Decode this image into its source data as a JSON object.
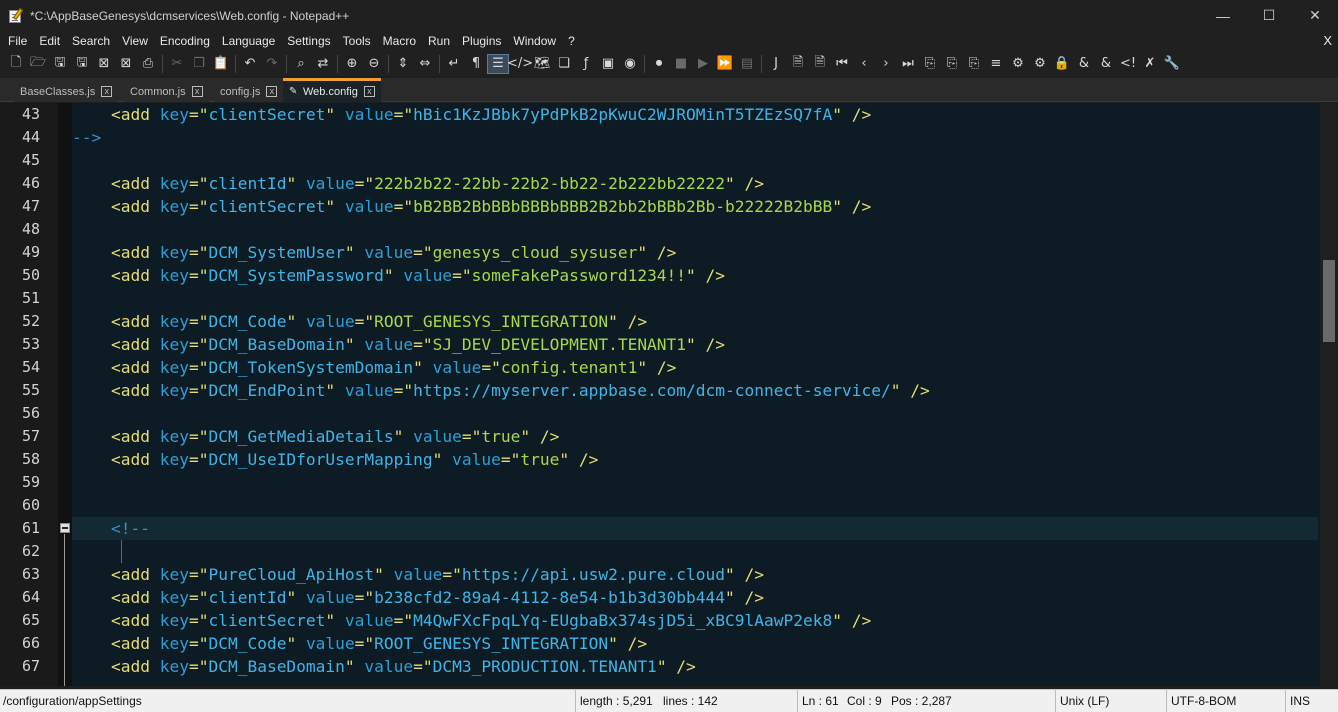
{
  "window": {
    "title": "*C:\\AppBaseGenesys\\dcmservices\\Web.config - Notepad++",
    "minimize_glyph": "—",
    "maximize_glyph": "☐",
    "close_glyph": "✕"
  },
  "menu": {
    "items": [
      "File",
      "Edit",
      "Search",
      "View",
      "Encoding",
      "Language",
      "Settings",
      "Tools",
      "Macro",
      "Run",
      "Plugins",
      "Window",
      "?"
    ],
    "close_glyph": "X"
  },
  "tabs": [
    {
      "label": "BaseClasses.js",
      "active": false
    },
    {
      "label": "Common.js",
      "active": false
    },
    {
      "label": "config.js",
      "active": false
    },
    {
      "label": "Web.config",
      "active": true
    }
  ],
  "tab_close_glyph": "x",
  "editor": {
    "current_line": 61,
    "lines": [
      {
        "n": "43",
        "parts": [
          [
            "t",
            "    <add "
          ],
          [
            "a",
            "key"
          ],
          [
            "t",
            "=\""
          ],
          [
            "s",
            "clientSecret"
          ],
          [
            "t",
            "\" "
          ],
          [
            "a",
            "value"
          ],
          [
            "t",
            "=\""
          ],
          [
            "s",
            "hBic1KzJBbk7yPdPkB2pKwuC2WJROMinT5TZEzSQ7fA"
          ],
          [
            "t",
            "\" />"
          ]
        ]
      },
      {
        "n": "44",
        "parts": [
          [
            "c",
            "-->"
          ]
        ]
      },
      {
        "n": "45",
        "parts": []
      },
      {
        "n": "46",
        "parts": [
          [
            "t",
            "    <add "
          ],
          [
            "a",
            "key"
          ],
          [
            "t",
            "=\""
          ],
          [
            "s",
            "clientId"
          ],
          [
            "t",
            "\" "
          ],
          [
            "a",
            "value"
          ],
          [
            "t",
            "=\""
          ],
          [
            "g",
            "222b2b22-22bb-22b2-bb22-2b222bb22222"
          ],
          [
            "t",
            "\" />"
          ]
        ]
      },
      {
        "n": "47",
        "parts": [
          [
            "t",
            "    <add "
          ],
          [
            "a",
            "key"
          ],
          [
            "t",
            "=\""
          ],
          [
            "s",
            "clientSecret"
          ],
          [
            "t",
            "\" "
          ],
          [
            "a",
            "value"
          ],
          [
            "t",
            "=\""
          ],
          [
            "g",
            "bB2BB2BbBBbBBBbBBB2B2bb2bBBb2Bb-b22222B2bBB"
          ],
          [
            "t",
            "\" />"
          ]
        ]
      },
      {
        "n": "48",
        "parts": []
      },
      {
        "n": "49",
        "parts": [
          [
            "t",
            "    <add "
          ],
          [
            "a",
            "key"
          ],
          [
            "t",
            "=\""
          ],
          [
            "s",
            "DCM_SystemUser"
          ],
          [
            "t",
            "\" "
          ],
          [
            "a",
            "value"
          ],
          [
            "t",
            "=\""
          ],
          [
            "g",
            "genesys_cloud_sysuser"
          ],
          [
            "t",
            "\" />"
          ]
        ]
      },
      {
        "n": "50",
        "parts": [
          [
            "t",
            "    <add "
          ],
          [
            "a",
            "key"
          ],
          [
            "t",
            "=\""
          ],
          [
            "s",
            "DCM_SystemPassword"
          ],
          [
            "t",
            "\" "
          ],
          [
            "a",
            "value"
          ],
          [
            "t",
            "=\""
          ],
          [
            "g",
            "someFakePassword1234!!"
          ],
          [
            "t",
            "\" />"
          ]
        ]
      },
      {
        "n": "51",
        "parts": []
      },
      {
        "n": "52",
        "parts": [
          [
            "t",
            "    <add "
          ],
          [
            "a",
            "key"
          ],
          [
            "t",
            "=\""
          ],
          [
            "s",
            "DCM_Code"
          ],
          [
            "t",
            "\" "
          ],
          [
            "a",
            "value"
          ],
          [
            "t",
            "=\""
          ],
          [
            "g",
            "ROOT_GENESYS_INTEGRATION"
          ],
          [
            "t",
            "\" />"
          ]
        ]
      },
      {
        "n": "53",
        "parts": [
          [
            "t",
            "    <add "
          ],
          [
            "a",
            "key"
          ],
          [
            "t",
            "=\""
          ],
          [
            "s",
            "DCM_BaseDomain"
          ],
          [
            "t",
            "\" "
          ],
          [
            "a",
            "value"
          ],
          [
            "t",
            "=\""
          ],
          [
            "g",
            "SJ_DEV_DEVELOPMENT.TENANT1"
          ],
          [
            "t",
            "\" />"
          ]
        ]
      },
      {
        "n": "54",
        "parts": [
          [
            "t",
            "    <add "
          ],
          [
            "a",
            "key"
          ],
          [
            "t",
            "=\""
          ],
          [
            "s",
            "DCM_TokenSystemDomain"
          ],
          [
            "t",
            "\" "
          ],
          [
            "a",
            "value"
          ],
          [
            "t",
            "=\""
          ],
          [
            "g",
            "config.tenant1"
          ],
          [
            "t",
            "\" />"
          ]
        ]
      },
      {
        "n": "55",
        "parts": [
          [
            "t",
            "    <add "
          ],
          [
            "a",
            "key"
          ],
          [
            "t",
            "=\""
          ],
          [
            "s",
            "DCM_EndPoint"
          ],
          [
            "t",
            "\" "
          ],
          [
            "a",
            "value"
          ],
          [
            "t",
            "=\""
          ],
          [
            "s",
            "https://myserver.appbase.com/dcm-connect-service/"
          ],
          [
            "t",
            "\" />"
          ]
        ]
      },
      {
        "n": "56",
        "parts": []
      },
      {
        "n": "57",
        "parts": [
          [
            "t",
            "    <add "
          ],
          [
            "a",
            "key"
          ],
          [
            "t",
            "=\""
          ],
          [
            "s",
            "DCM_GetMediaDetails"
          ],
          [
            "t",
            "\" "
          ],
          [
            "a",
            "value"
          ],
          [
            "t",
            "=\""
          ],
          [
            "g",
            "true"
          ],
          [
            "t",
            "\" />"
          ]
        ]
      },
      {
        "n": "58",
        "parts": [
          [
            "t",
            "    <add "
          ],
          [
            "a",
            "key"
          ],
          [
            "t",
            "=\""
          ],
          [
            "s",
            "DCM_UseIDforUserMapping"
          ],
          [
            "t",
            "\" "
          ],
          [
            "a",
            "value"
          ],
          [
            "t",
            "=\""
          ],
          [
            "g",
            "true"
          ],
          [
            "t",
            "\" />"
          ]
        ]
      },
      {
        "n": "59",
        "parts": []
      },
      {
        "n": "60",
        "parts": []
      },
      {
        "n": "61",
        "parts": [
          [
            "c",
            "    <!--"
          ]
        ]
      },
      {
        "n": "62",
        "parts": []
      },
      {
        "n": "63",
        "parts": [
          [
            "t",
            "    <add "
          ],
          [
            "a",
            "key"
          ],
          [
            "t",
            "=\""
          ],
          [
            "s",
            "PureCloud_ApiHost"
          ],
          [
            "t",
            "\" "
          ],
          [
            "a",
            "value"
          ],
          [
            "t",
            "=\""
          ],
          [
            "s",
            "https://api.usw2.pure.cloud"
          ],
          [
            "t",
            "\" />"
          ]
        ]
      },
      {
        "n": "64",
        "parts": [
          [
            "t",
            "    <add "
          ],
          [
            "a",
            "key"
          ],
          [
            "t",
            "=\""
          ],
          [
            "s",
            "clientId"
          ],
          [
            "t",
            "\" "
          ],
          [
            "a",
            "value"
          ],
          [
            "t",
            "=\""
          ],
          [
            "s",
            "b238cfd2-89a4-4112-8e54-b1b3d30bb444"
          ],
          [
            "t",
            "\" />"
          ]
        ]
      },
      {
        "n": "65",
        "parts": [
          [
            "t",
            "    <add "
          ],
          [
            "a",
            "key"
          ],
          [
            "t",
            "=\""
          ],
          [
            "s",
            "clientSecret"
          ],
          [
            "t",
            "\" "
          ],
          [
            "a",
            "value"
          ],
          [
            "t",
            "=\""
          ],
          [
            "s",
            "M4QwFXcFpqLYq-EUgbaBx374sjD5i_xBC9lAawP2ek8"
          ],
          [
            "t",
            "\" />"
          ]
        ]
      },
      {
        "n": "66",
        "parts": [
          [
            "t",
            "    <add "
          ],
          [
            "a",
            "key"
          ],
          [
            "t",
            "=\""
          ],
          [
            "s",
            "DCM_Code"
          ],
          [
            "t",
            "\" "
          ],
          [
            "a",
            "value"
          ],
          [
            "t",
            "=\""
          ],
          [
            "s",
            "ROOT_GENESYS_INTEGRATION"
          ],
          [
            "t",
            "\" />"
          ]
        ]
      },
      {
        "n": "67",
        "parts": [
          [
            "t",
            "    <add "
          ],
          [
            "a",
            "key"
          ],
          [
            "t",
            "=\""
          ],
          [
            "s",
            "DCM_BaseDomain"
          ],
          [
            "t",
            "\" "
          ],
          [
            "a",
            "value"
          ],
          [
            "t",
            "=\""
          ],
          [
            "s",
            "DCM3_PRODUCTION.TENANT1"
          ],
          [
            "t",
            "\" />"
          ]
        ]
      }
    ]
  },
  "statusbar": {
    "path": "/configuration/appSettings",
    "length": "length : 5,291",
    "lines": "lines : 142",
    "ln": "Ln : 61",
    "col": "Col : 9",
    "pos": "Pos : 2,287",
    "eol": "Unix (LF)",
    "encoding": "UTF-8-BOM",
    "mode": "INS"
  },
  "colors": {
    "accent_tab": "#f0a030",
    "editor_bg": "#0d1c24",
    "attr": "#2d9fd8",
    "tag": "#e6db74",
    "string_green": "#a6d84a"
  }
}
